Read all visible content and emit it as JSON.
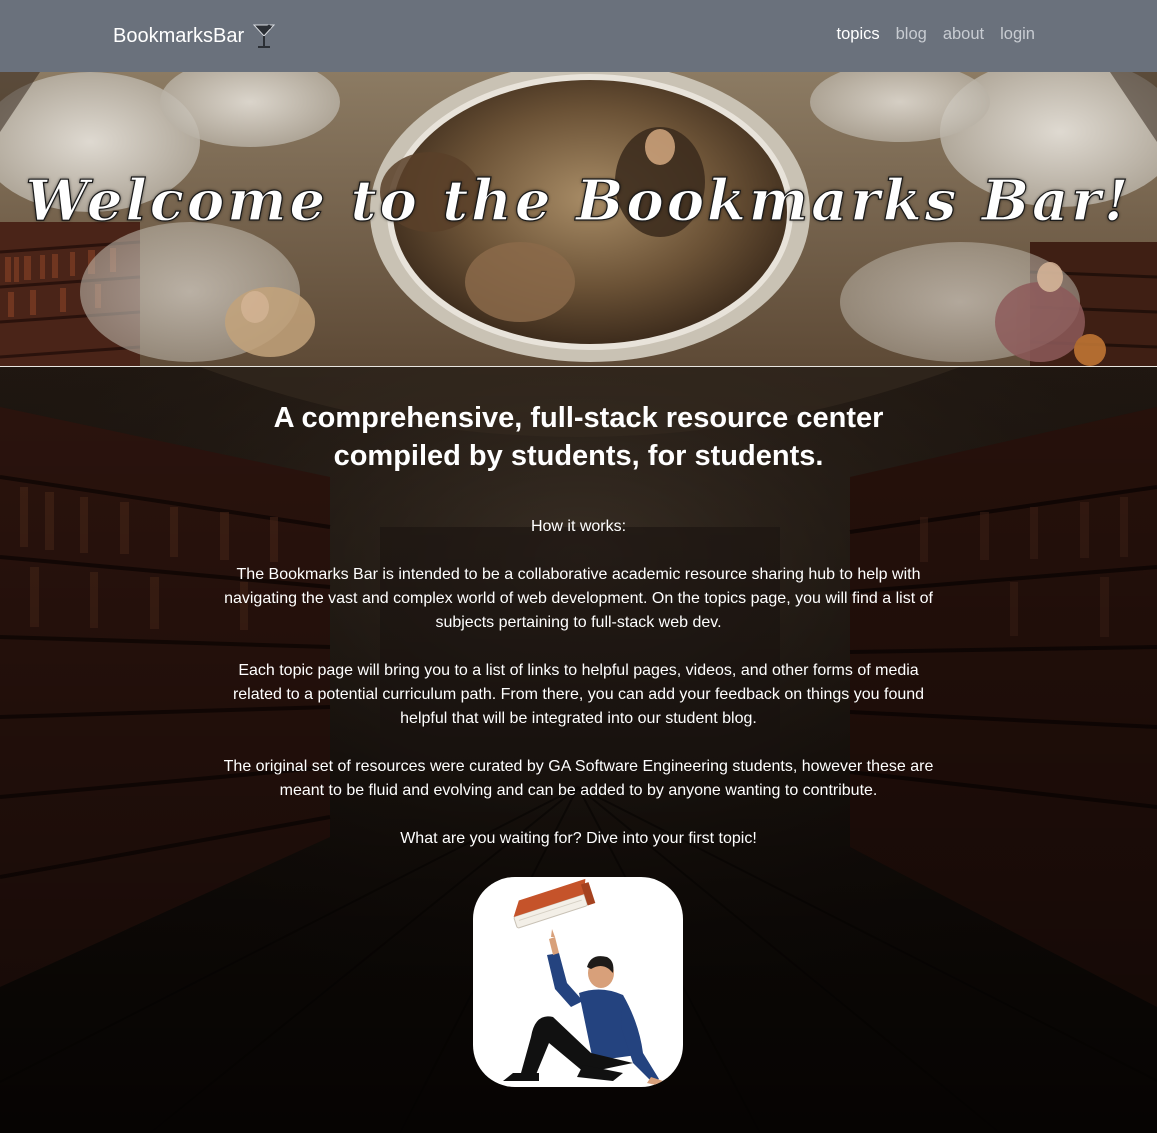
{
  "navbar": {
    "brand": "BookmarksBar",
    "brand_icon": "cocktail-glass-icon",
    "links": [
      {
        "label": "topics",
        "active": true
      },
      {
        "label": "blog",
        "active": false
      },
      {
        "label": "about",
        "active": false
      },
      {
        "label": "login",
        "active": false
      }
    ]
  },
  "hero": {
    "title": "Welcome to the Bookmarks Bar!"
  },
  "main": {
    "tagline": "A comprehensive, full-stack resource center compiled by students, for students.",
    "how_label": "How it works:",
    "paragraphs": [
      "The Bookmarks Bar is intended to be a collaborative academic resource sharing hub to help with navigating the vast and complex world of web development. On the topics page, you will find a list of subjects pertaining to full-stack web dev.",
      "Each topic page will bring you to a list of links to helpful pages, videos, and other forms of media related to a potential curriculum path. From there, you can add your feedback on things you found helpful that will be integrated into our student blog.",
      "The original set of resources were curated by GA Software Engineering students, however these are meant to be fluid and evolving and can be added to by anyone wanting to contribute."
    ],
    "cta": "What are you waiting for? Dive into your first topic!",
    "illustration_icon": "person-pointing-at-book-icon"
  },
  "colors": {
    "navbar_bg": "#6a717c",
    "nav_active": "#ffffff",
    "nav_inactive": "#c8ccd2",
    "book_cover": "#c5532a",
    "shirt": "#24437f"
  }
}
